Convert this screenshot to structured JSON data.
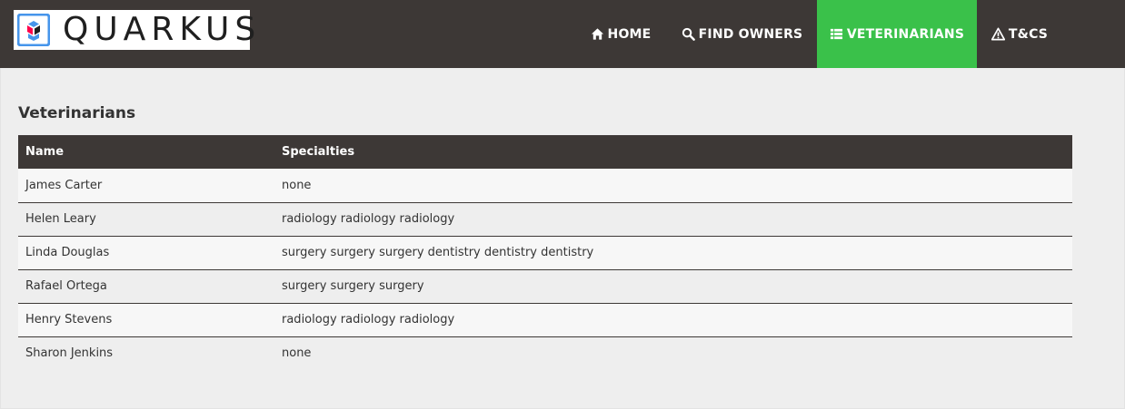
{
  "brand": {
    "name": "QUARKUS",
    "colors": {
      "nav_bg": "#3d3836",
      "active": "#3ac14a",
      "logo_blue": "#4695eb",
      "logo_red": "#ff004a"
    }
  },
  "nav": {
    "items": [
      {
        "label": "HOME",
        "icon": "home-icon",
        "active": false
      },
      {
        "label": "FIND OWNERS",
        "icon": "search-icon",
        "active": false
      },
      {
        "label": "VETERINARIANS",
        "icon": "list-icon",
        "active": true
      },
      {
        "label": "T&CS",
        "icon": "warning-icon",
        "active": false
      }
    ]
  },
  "page": {
    "title": "Veterinarians"
  },
  "table": {
    "headers": [
      "Name",
      "Specialties"
    ],
    "rows": [
      {
        "name": "James Carter",
        "specialties": "none"
      },
      {
        "name": "Helen Leary",
        "specialties": "radiology radiology radiology"
      },
      {
        "name": "Linda Douglas",
        "specialties": "surgery surgery surgery dentistry dentistry dentistry"
      },
      {
        "name": "Rafael Ortega",
        "specialties": "surgery surgery surgery"
      },
      {
        "name": "Henry Stevens",
        "specialties": "radiology radiology radiology"
      },
      {
        "name": "Sharon Jenkins",
        "specialties": "none"
      }
    ]
  }
}
